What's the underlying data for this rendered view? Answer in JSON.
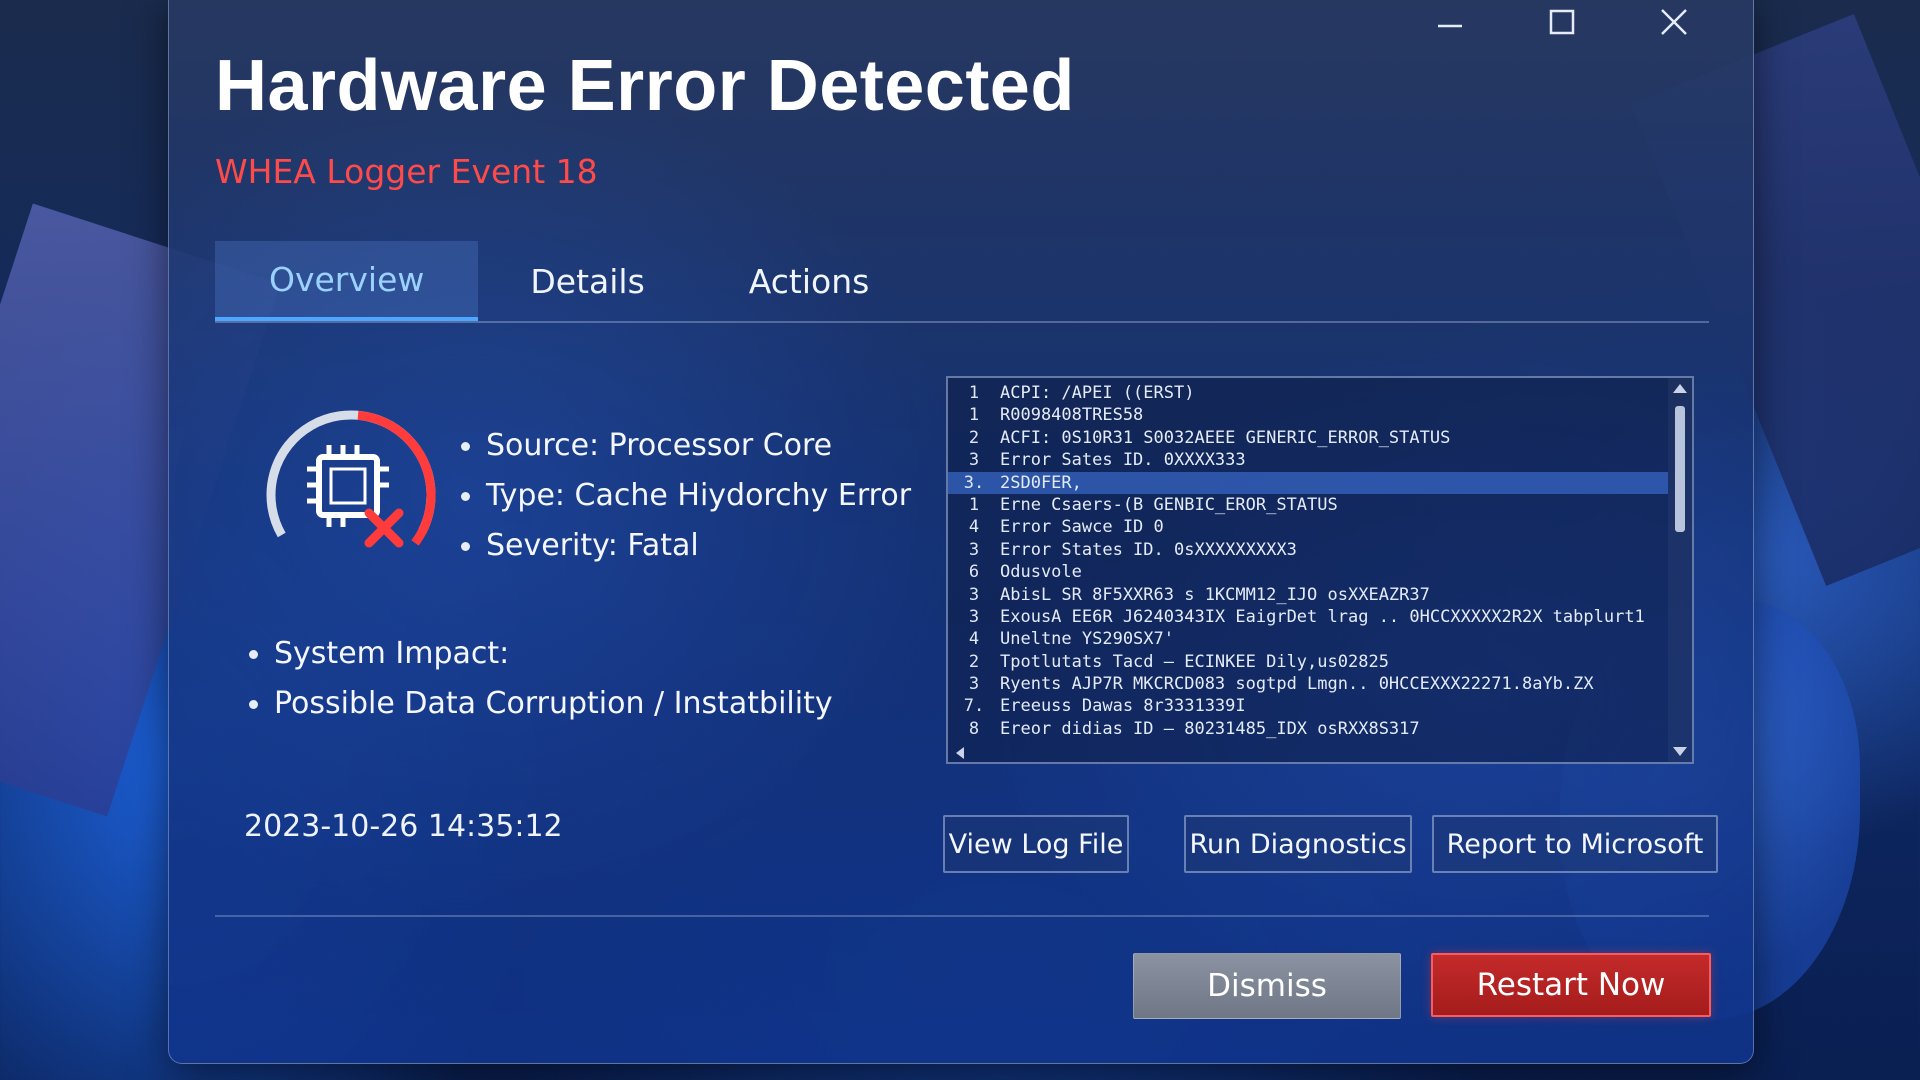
{
  "window": {
    "title": "Hardware Error Detected",
    "subtitle": "WHEA Logger Event 18",
    "controls": [
      "minimize",
      "maximize",
      "close"
    ]
  },
  "tabs": [
    {
      "label": "Overview",
      "active": true
    },
    {
      "label": "Details",
      "active": false
    },
    {
      "label": "Actions",
      "active": false
    }
  ],
  "summary": {
    "icon": "cpu-error-icon",
    "source": "Source: Processor Core",
    "type": "Type: Cache Hiydorchy Error",
    "severity": "Severity: Fatal",
    "impact_label": "System Impact:",
    "impact_value": "Possible Data Corruption / Instatbility",
    "timestamp": "2023-10-26 14:35:12"
  },
  "log": {
    "selected_index": 4,
    "lines": [
      {
        "n": "1",
        "text": "ACPI: /APEI ((ERST)"
      },
      {
        "n": "1",
        "text": "R0098408TRES58"
      },
      {
        "n": "2",
        "text": "  ACFI: 0S10R31 S0032AEEE GENERIC_ERROR_STATUS"
      },
      {
        "n": "3",
        "text": "  Error Sates ID. 0XXXX333"
      },
      {
        "n": "3.",
        "text": "2SD0FER,"
      },
      {
        "n": "1",
        "text": "  Erne Csaers-(B GENBIC_EROR_STATUS"
      },
      {
        "n": "4",
        "text": "  Error Sawce ID 0"
      },
      {
        "n": "3",
        "text": "  Error States ID. 0sXXXXXXXXX3"
      },
      {
        "n": "6",
        "text": "  Odusvole"
      },
      {
        "n": "3",
        "text": "  AbisL SR 8F5XXR63 s 1KCMM12_IJO osXXEAZR37"
      },
      {
        "n": "3",
        "text": "  ExousA EE6R J6240343IX EaigrDet lrag .. 0HCCXXXXX2R2X tabplurt1"
      },
      {
        "n": "4",
        "text": "  Uneltne YS290SX7'"
      },
      {
        "n": "2",
        "text": "  Tpotlutats Tacd — ECINKEE Dily,us02825"
      },
      {
        "n": "3",
        "text": "  Ryents AJP7R MKCRCD083 sogtpd Lmgn.. 0HCCEXXX22271.8aYb.ZX"
      },
      {
        "n": "7.",
        "text": "  Ereeuss Dawas 8r3331339I"
      },
      {
        "n": "8",
        "text": "  Ereor didias ID — 80231485_IDX osRXX8S317"
      }
    ]
  },
  "actions": {
    "view_log": "View Log File",
    "diagnostics": "Run Diagnostics",
    "report": "Report to Microsoft"
  },
  "footer": {
    "dismiss": "Dismiss",
    "restart": "Restart Now"
  },
  "colors": {
    "accent_red": "#ff4a4a",
    "tab_active": "#4da6ff",
    "restart_bg": "#b32222",
    "dismiss_bg": "#7c8494"
  }
}
